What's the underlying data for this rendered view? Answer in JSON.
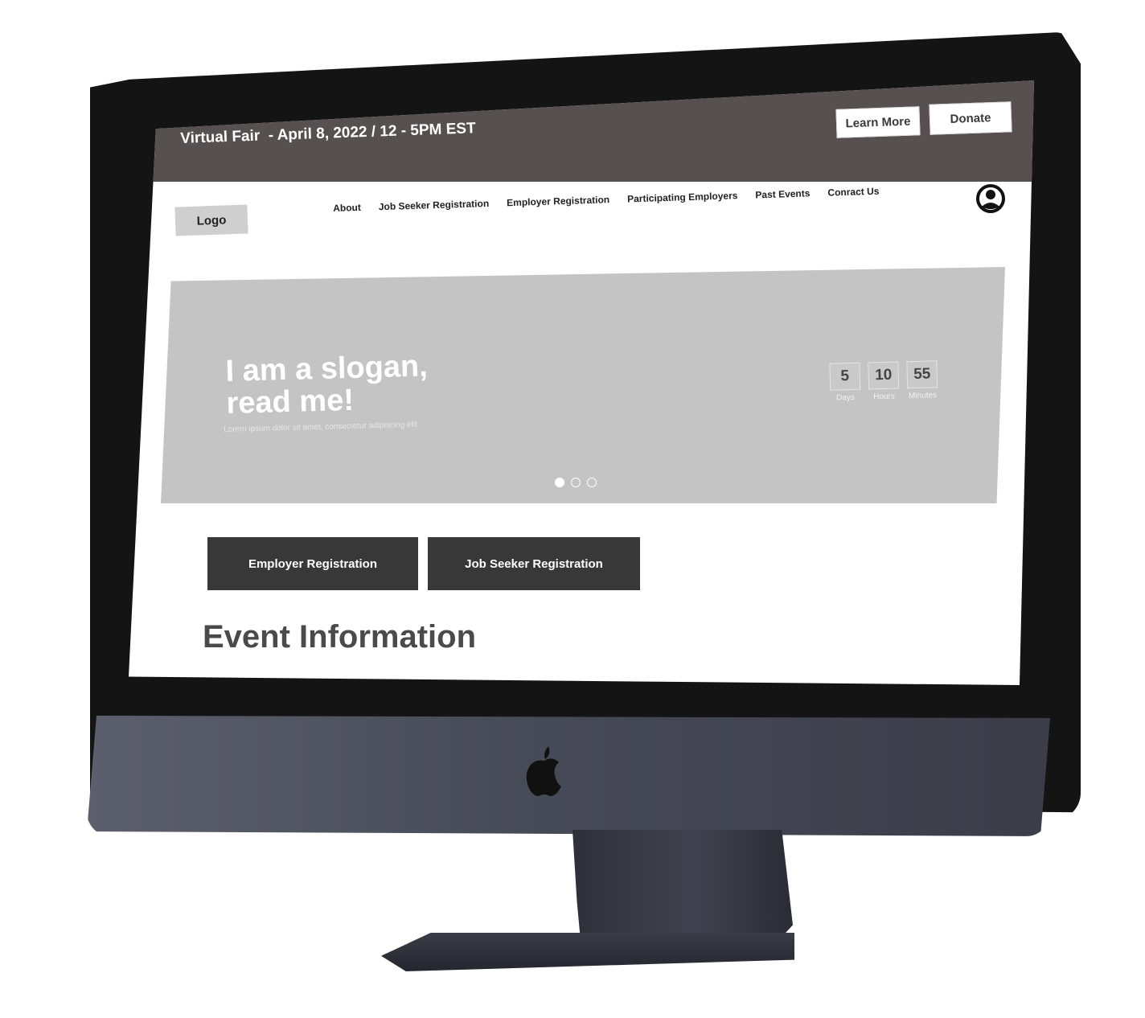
{
  "topbar": {
    "title": "Virtual Fair  - April 8, 2022 / 12 - 5PM EST",
    "learn_more": "Learn More",
    "donate": "Donate",
    "bg_color": "#575050"
  },
  "nav": {
    "logo": "Logo",
    "links": [
      "About",
      "Job Seeker Registration",
      "Employer Registration",
      "Participating Employers",
      "Past Events",
      "Conract Us"
    ],
    "account_icon": "user-circle-icon"
  },
  "hero": {
    "slogan_line1": "I am a slogan,",
    "slogan_line2": "read me!",
    "subtext": "Lorem ipsum dolor sit amet, consectetur adipiscing elit",
    "countdown": [
      {
        "value": "5",
        "label": "Days"
      },
      {
        "value": "10",
        "label": "Hours"
      },
      {
        "value": "55",
        "label": "Minutes"
      }
    ],
    "carousel_dots": 3,
    "active_dot": 1,
    "bg_color": "#c4c4c4"
  },
  "cta": {
    "employer": "Employer Registration",
    "job_seeker": "Job Seeker Registration",
    "bg_color": "#383838"
  },
  "section": {
    "title": "Event Information"
  },
  "device": {
    "brand_icon": "apple-icon"
  }
}
